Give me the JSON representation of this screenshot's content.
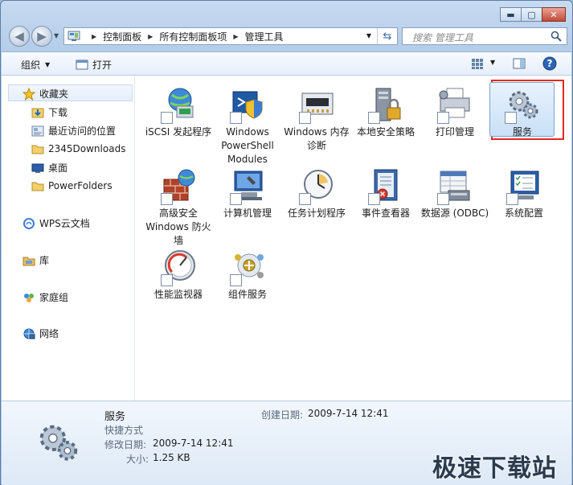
{
  "window": {
    "controls": {
      "minimize": "▬",
      "maximize": "▢",
      "close": "✕"
    }
  },
  "nav": {
    "back_icon": "back-arrow-icon",
    "forward_icon": "forward-arrow-icon",
    "breadcrumbs": [
      "控制面板",
      "所有控制面板项",
      "管理工具"
    ],
    "search_placeholder": "搜索 管理工具"
  },
  "toolbar": {
    "organize_label": "组织",
    "open_label": "打开"
  },
  "sidebar": {
    "favorites_label": "收藏夹",
    "favorites": [
      "下载",
      "最近访问的位置",
      "2345Downloads",
      "桌面",
      "PowerFolders"
    ],
    "wps": "WPS云文档",
    "library": "库",
    "homegroup": "家庭组",
    "network": "网络"
  },
  "items": [
    {
      "label": "iSCSI 发起程序",
      "icon": "globe-network-icon"
    },
    {
      "label": "Windows PowerShell Modules",
      "icon": "powershell-shield-icon"
    },
    {
      "label": "Windows 内存诊断",
      "icon": "memory-chip-icon"
    },
    {
      "label": "本地安全策略",
      "icon": "server-lock-icon"
    },
    {
      "label": "打印管理",
      "icon": "printer-icon"
    },
    {
      "label": "服务",
      "icon": "gears-icon",
      "selected": true
    },
    {
      "label": "高级安全 Windows 防火墙",
      "icon": "firewall-icon"
    },
    {
      "label": "计算机管理",
      "icon": "computer-management-icon"
    },
    {
      "label": "任务计划程序",
      "icon": "clock-schedule-icon"
    },
    {
      "label": "事件查看器",
      "icon": "event-log-icon"
    },
    {
      "label": "数据源 (ODBC)",
      "icon": "database-icon"
    },
    {
      "label": "系统配置",
      "icon": "system-config-icon"
    },
    {
      "label": "性能监视器",
      "icon": "gauge-icon"
    },
    {
      "label": "组件服务",
      "icon": "component-services-icon"
    }
  ],
  "details": {
    "name": "服务",
    "type": "快捷方式",
    "modified_label": "修改日期:",
    "modified_value": "2009-7-14 12:41",
    "size_label": "大小:",
    "size_value": "1.25 KB",
    "created_label": "创建日期:",
    "created_value": "2009-7-14 12:41"
  },
  "watermark": "极速下载站",
  "colors": {
    "accent": "#3b6ea5",
    "highlight_border": "#e02a20",
    "selection": "#c9e0f7"
  }
}
